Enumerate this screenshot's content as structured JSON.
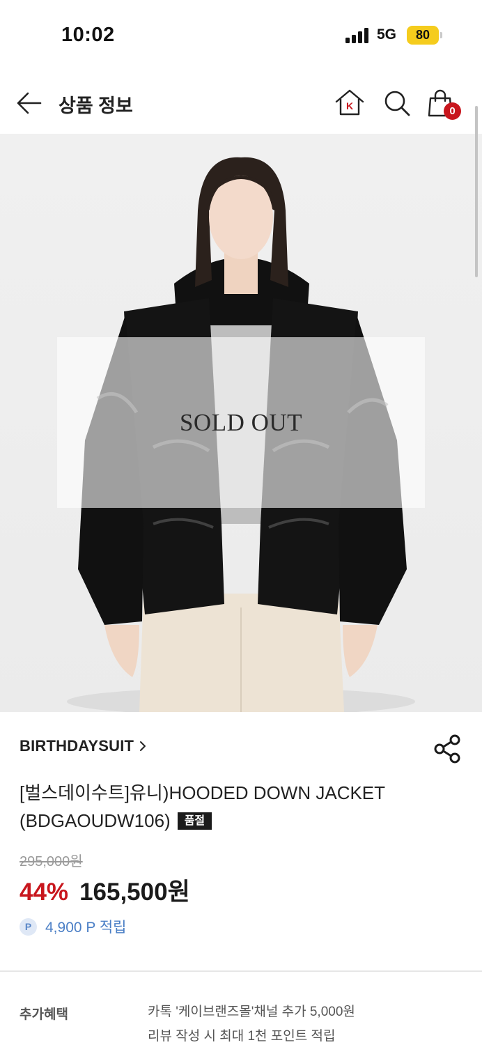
{
  "status_bar": {
    "time": "10:02",
    "network": "5G",
    "battery": "80"
  },
  "header": {
    "title": "상품 정보",
    "home_icon_letter": "K",
    "cart_count": "0"
  },
  "product": {
    "image_overlay_text": "SOLD OUT",
    "brand": "BIRTHDAYSUIT",
    "title": "[벌스데이수트]유니)HOODED DOWN JACKET (BDGAOUDW106)",
    "status_badge": "품절",
    "original_price": "295,000원",
    "discount_rate": "44%",
    "sale_price": "165,500원",
    "points_icon_label": "P",
    "points": "4,900 P 적립"
  },
  "benefits": {
    "label": "추가혜택",
    "items": [
      "카톡 '케이브랜즈몰'채널 추가 5,000원",
      "리뷰 작성 시 최대 1천 포인트 적립"
    ]
  },
  "colors": {
    "accent_red": "#c8161d",
    "points_blue": "#4b7fc6",
    "battery_yellow": "#f5cc1d"
  }
}
